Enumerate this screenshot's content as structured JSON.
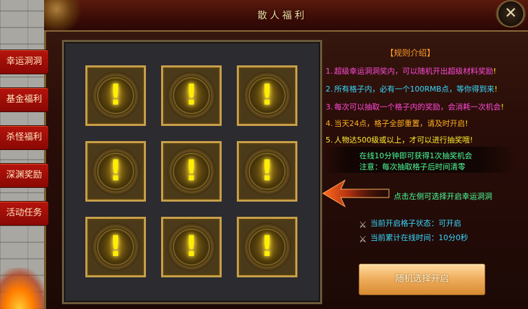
{
  "window": {
    "title": "散人福利",
    "close_icon": "close-swords-icon"
  },
  "sidebar": {
    "items": [
      {
        "label": "幸运洞洞"
      },
      {
        "label": "基金福利"
      },
      {
        "label": "杀怪福利"
      },
      {
        "label": "深渊奖励"
      },
      {
        "label": "活动任务"
      }
    ]
  },
  "grid": {
    "cells": [
      "!",
      "!",
      "!",
      "!",
      "!",
      "!",
      "!",
      "!",
      "!"
    ],
    "icon": "exclamation-icon"
  },
  "rules": {
    "title": "【规则介绍】",
    "items": [
      {
        "num": "1.",
        "text": "超级幸运洞洞奖内，可以随机开出超级材料奖励",
        "color": "#ff4ad8"
      },
      {
        "num": "2.",
        "text": "所有格子内，必有一个100RMB点，等你得到来",
        "color": "#38d8ff"
      },
      {
        "num": "3.",
        "text": "每次可以抽取一个格子内的奖励，会消耗一次机会",
        "color": "#ff4ad8"
      },
      {
        "num": "4.",
        "text": "当天24点，格子全部重置，请及时开启",
        "color": "#ffb020"
      },
      {
        "num": "5.",
        "text": "人物达500级或以上，才可以进行抽奖哦",
        "color": "#ffee33"
      }
    ],
    "excl_mark": "!"
  },
  "info": {
    "line1": "在线10分钟即可获得1次抽奖机会",
    "line2": "注意：每次抽取格子后时间清零"
  },
  "hint": "点击左侧可选择开启幸运洞洞",
  "status": {
    "state_label": "当前开启格子状态：可开启",
    "time_label": "当前累计在线时间：10分0秒",
    "icon": "crossed-swords-icon"
  },
  "open_button": "随机选择开启",
  "colors": {
    "accent": "#c8a04a",
    "menu": "#b5140c",
    "green": "#4dff9a",
    "cyan": "#38d8ff"
  }
}
